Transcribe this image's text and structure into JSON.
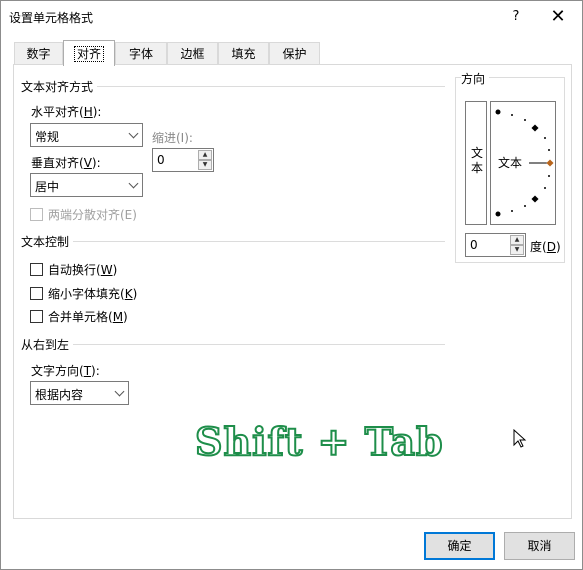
{
  "window": {
    "title": "设置单元格格式",
    "help": "?",
    "close": "✕"
  },
  "tabs": [
    "数字",
    "对齐",
    "字体",
    "边框",
    "填充",
    "保护"
  ],
  "text_alignment": {
    "group_title": "文本对齐方式",
    "horizontal_label": "水平对齐(",
    "horizontal_key": "H",
    "horizontal_suffix": "):",
    "horizontal_value": "常规",
    "indent_label": "缩进(I):",
    "indent_value": "0",
    "vertical_label": "垂直对齐(",
    "vertical_key": "V",
    "vertical_suffix": "):",
    "vertical_value": "居中",
    "distributed_label": "两端分散对齐(E)"
  },
  "text_control": {
    "group_title": "文本控制",
    "wrap_label": "自动换行(",
    "wrap_key": "W",
    "shrink_label": "缩小字体填充(",
    "shrink_key": "K",
    "merge_label": "合并单元格(",
    "merge_key": "M",
    "close_paren": ")"
  },
  "rtl": {
    "group_title": "从右到左",
    "direction_label": "文字方向(",
    "direction_key": "T",
    "direction_suffix": "):",
    "direction_value": "根据内容"
  },
  "orientation": {
    "group_title": "方向",
    "vertical_text_1": "文",
    "vertical_text_2": "本",
    "dial_text": "文本",
    "degree_value": "0",
    "degree_label": "度(",
    "degree_key": "D",
    "degree_suffix": ")"
  },
  "overlay": {
    "shortcut_text": "Shift + Tab"
  },
  "buttons": {
    "ok": "确定",
    "cancel": "取消"
  },
  "colors": {
    "accent": "#0078d7",
    "shortcut_stroke": "#1e8e4a",
    "dial_marker": "#b8651c"
  }
}
